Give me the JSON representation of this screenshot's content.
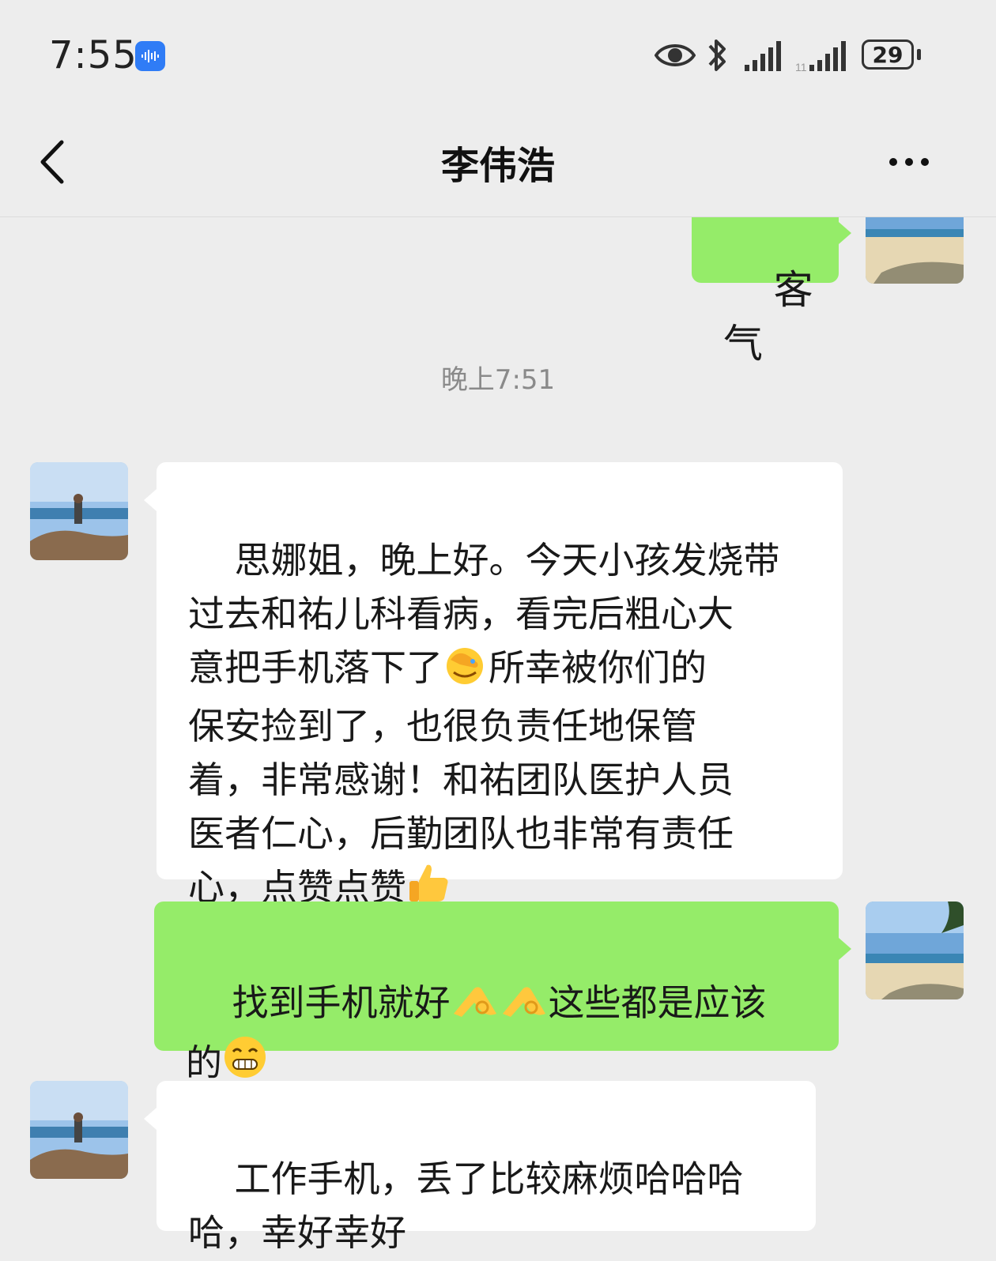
{
  "status_bar": {
    "time": "7:55",
    "battery": "29",
    "icons": [
      "voice-assistant-icon",
      "eye-icon",
      "bluetooth-icon",
      "signal-icon",
      "signal-icon"
    ]
  },
  "header": {
    "title": "李伟浩",
    "back_icon": "chevron-left-icon",
    "more_icon": "more-icon"
  },
  "messages": [
    {
      "side": "right",
      "text": "客气"
    },
    {
      "type": "timestamp",
      "text": "晚上7:51"
    },
    {
      "side": "left",
      "text_parts": [
        "思娜姐，晚上好。今天小孩发烧带\n过去和祐儿科看病，看完后粗心大\n意把手机落下了",
        "所幸被你们的\n保安捡到了，也很负责任地保管\n着，非常感谢！和祐团队医护人员\n医者仁心，后勤团队也非常有责任\n心，点赞点赞"
      ],
      "emojis": [
        "facepalm-emoji",
        "thumbs-up-emoji"
      ]
    },
    {
      "side": "right",
      "text_parts": [
        "找到手机就好",
        "这些都是应该\n的"
      ],
      "emojis": [
        "ok-hand-emoji",
        "ok-hand-emoji",
        "grin-emoji"
      ]
    },
    {
      "side": "left",
      "text": "工作手机，丢了比较麻烦哈哈哈\n哈，幸好幸好"
    }
  ],
  "colors": {
    "background": "#ededed",
    "sent_bubble": "#95ec69",
    "received_bubble": "#ffffff",
    "timestamp": "#8a8a8a"
  }
}
